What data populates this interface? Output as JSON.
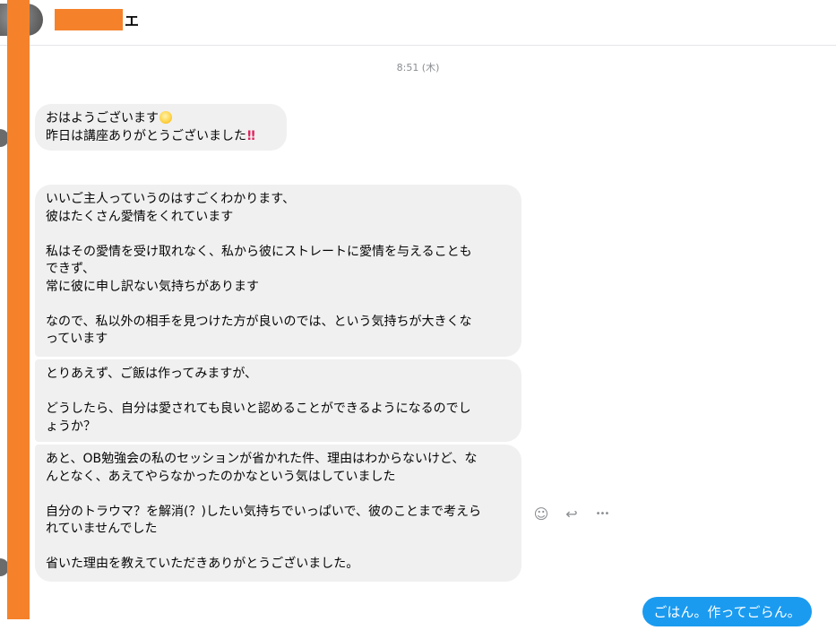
{
  "header": {
    "name_visible": "エ"
  },
  "conversation": {
    "timestamp": "8:51 (木)",
    "messages": [
      {
        "line1": "おはようございます",
        "line2": "昨日は講座ありがとうございました",
        "bang": "‼"
      },
      {
        "text": "いいご主人っていうのはすごくわかります、\n彼はたくさん愛情をくれています\n\n私はその愛情を受け取れなく、私から彼にストレートに愛情を与えることも\nできず、\n常に彼に申し訳ない気持ちがあります\n\nなので、私以外の相手を見つけた方が良いのでは、という気持ちが大きくな\nっています"
      },
      {
        "text": "とりあえず、ご飯は作ってみますが、\n\nどうしたら、自分は愛されても良いと認めることができるようになるのでし\nょうか？"
      },
      {
        "text": "あと、OB勉強会の私のセッションが省かれた件、理由はわからないけど、な\nんとなく、あえてやらなかったのかなという気はしていました\n\n自分のトラウマ？を解消(？)したい気持ちでいっぱいで、彼のことまで考えら\nれていませんでした\n\n省いた理由を教えていただきありがとうございました。"
      }
    ],
    "sent_message": "ごはん。作ってごらん。"
  },
  "message_actions": {
    "react_glyph": "☺",
    "reply_glyph": "↩",
    "more_glyph": "•••"
  },
  "icons": {
    "emoji_sun": "sun-emoji-icon",
    "react": "smiley-icon",
    "reply": "reply-arrow-icon",
    "more": "more-dots-icon"
  },
  "colors": {
    "redaction": "#f5822a",
    "sent_bubble": "#1a9bf0",
    "received_bubble": "#f0f0f0",
    "timestamp": "#8a8d91"
  }
}
